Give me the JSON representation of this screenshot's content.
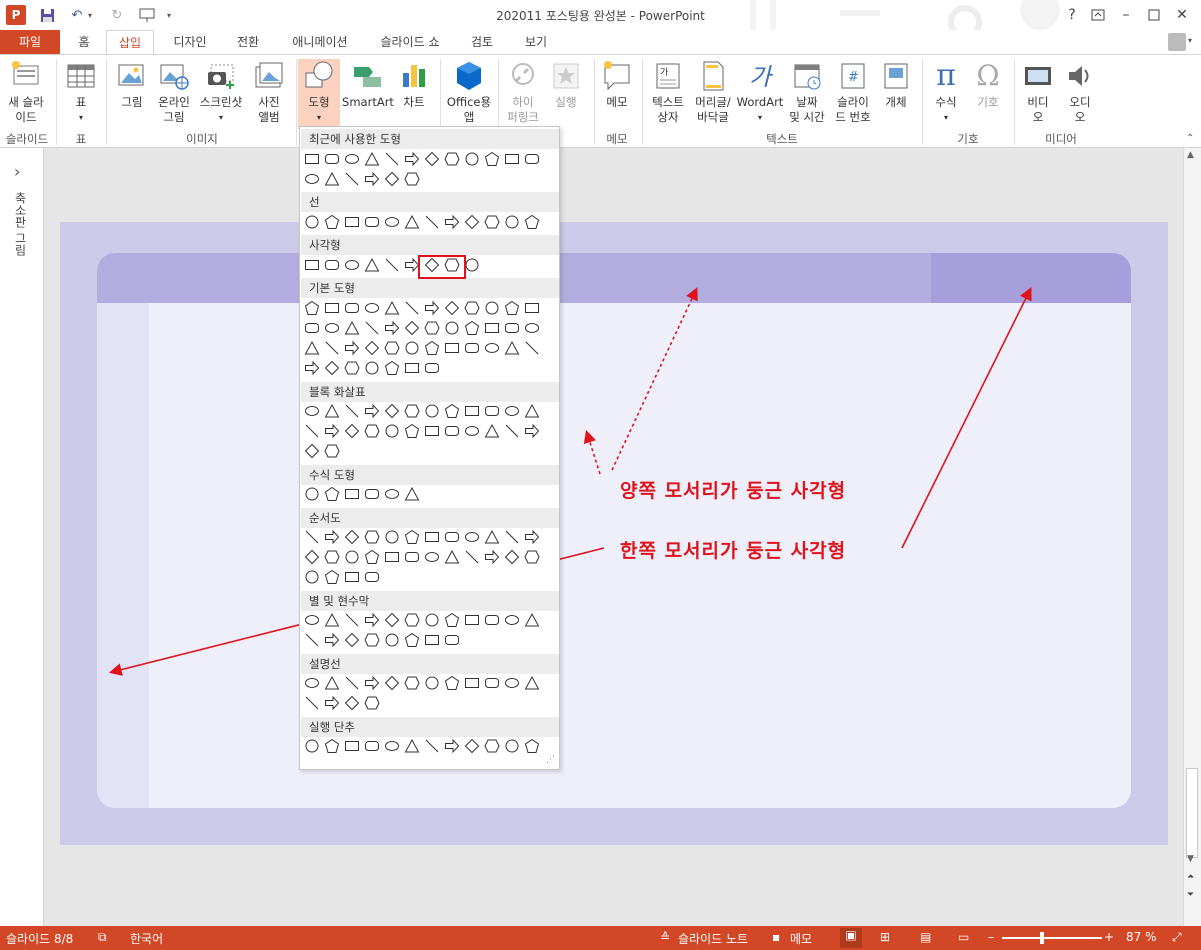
{
  "title_bar": {
    "title": "202011 포스팅용 완성본 - PowerPoint",
    "help": "?",
    "app_icon_label": "P"
  },
  "tabs": [
    "파일",
    "홈",
    "삽입",
    "디자인",
    "전환",
    "애니메이션",
    "슬라이드 쇼",
    "검토",
    "보기"
  ],
  "ribbon": {
    "new_slide": "새 슬라\n이드",
    "table": "표",
    "picture": "그림",
    "online_picture": "온라인\n그림",
    "screenshot": "스크린샷",
    "photo_album": "사진\n앨범",
    "shapes": "도형",
    "smartart": "SmartArt",
    "chart": "차트",
    "office_apps": "Office용\n앱",
    "hyperlink": "하이\n퍼링크",
    "action": "실행",
    "comment": "메모",
    "textbox": "텍스트\n상자",
    "header_footer": "머리글/\n바닥글",
    "wordart": "WordArt",
    "date_time": "날짜\n및 시간",
    "slide_number": "슬라이\n드 번호",
    "object": "개체",
    "equation": "수식",
    "symbol": "기호",
    "video": "비디\n오",
    "audio": "오디\n오",
    "groups": {
      "slides": "슬라이드",
      "tables": "표",
      "images": "이미지",
      "comments": "메모",
      "text": "텍스트",
      "symbols": "기호",
      "media": "미디어"
    }
  },
  "left_panel": {
    "label": "축소판 그림",
    "toggle": "›"
  },
  "shapes_menu": {
    "categories": [
      "최근에 사용한 도형",
      "선",
      "사각형",
      "기본 도형",
      "블록 화살표",
      "수식 도형",
      "순서도",
      "별 및 현수막",
      "설명선",
      "실행 단추"
    ]
  },
  "annotations": {
    "both_corners": "양쪽 모서리가 둥근 사각형",
    "one_corner": "한쪽 모서리가 둥근 사각형"
  },
  "colors": {
    "accent": "#d24726",
    "slide_bg": "#cdc9e8",
    "annotation": "#e0121b"
  },
  "status_bar": {
    "slide_info": "슬라이드 8/8",
    "language": "한국어",
    "notes": "슬라이드 노트",
    "comments": "메모",
    "zoom": "87 %"
  }
}
